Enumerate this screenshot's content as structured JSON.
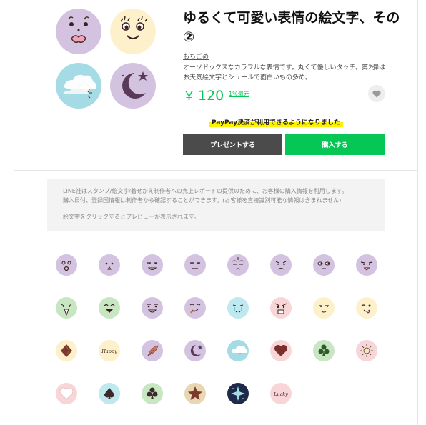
{
  "product": {
    "title": "ゆるくて可愛い表情の絵文字、その②",
    "author": "もちごめ",
    "description": "オーソドックスなカラフルな表情です。丸くて優しいタッチ。第2弾はお天気絵文字とシュールで面白いもの多め。",
    "price_symbol": "￥",
    "price_value": "120",
    "coin_link": "1%還元",
    "favorite_icon": "heart-icon",
    "paypay_notice": "PayPay決済が利用できるようになりました",
    "present_label": "プレゼントする",
    "buy_label": "購入する"
  },
  "colors": {
    "accent": "#06c755",
    "dark_button": "#4b4b4b",
    "highlight": "#fff200",
    "lavender": "#d3c3e0",
    "cream": "#fdf1cc",
    "sky": "#a5dbe4",
    "mint": "#c8e6c2",
    "peach": "#fbe0cb",
    "pink": "#f8d6d8",
    "brown": "#7a3b2a"
  },
  "main_images": [
    {
      "name": "lips-face",
      "icon": "lips-face-icon"
    },
    {
      "name": "curly-eyes-face",
      "icon": "smile-face-icon"
    },
    {
      "name": "cloudy-sun",
      "icon": "cloud-sun-icon"
    },
    {
      "name": "moon-star",
      "icon": "moon-star-icon"
    }
  ],
  "notice": {
    "line1": "LINE社はスタンプ/絵文字/着せかえ制作者への売上レポートの提供のために、お客様の購入情報を利用します。",
    "line2": "購入日付、登録国情報は制作者から確認することができます。(お客様を直接識別可能な情報は含まれません)",
    "line3": "絵文字をクリックするとプレビューが表示されます。"
  },
  "emojis": [
    {
      "icon": "surprised-face-icon"
    },
    {
      "icon": "small-mouth-face-icon"
    },
    {
      "icon": "grin-face-icon"
    },
    {
      "icon": "flat-face-icon"
    },
    {
      "icon": "sweating-face-icon"
    },
    {
      "icon": "worried-face-icon"
    },
    {
      "icon": "side-eye-face-icon"
    },
    {
      "icon": "tongue-face-icon"
    },
    {
      "icon": "shout-face-icon"
    },
    {
      "icon": "laughing-face-icon"
    },
    {
      "icon": "smirk-face-icon"
    },
    {
      "icon": "drool-face-icon"
    },
    {
      "icon": "crying-face-icon"
    },
    {
      "icon": "angry-face-icon"
    },
    {
      "icon": "smug-face-icon"
    },
    {
      "icon": "wink-tongue-face-icon"
    },
    {
      "icon": "chocolate-diamond-icon"
    },
    {
      "icon": "happy-text-icon",
      "text": "Happy"
    },
    {
      "icon": "feather-icon"
    },
    {
      "icon": "moon-star-icon"
    },
    {
      "icon": "cloudy-icon"
    },
    {
      "icon": "heart-icon"
    },
    {
      "icon": "club-icon"
    },
    {
      "icon": "sun-icon"
    },
    {
      "icon": "heart-outline-icon"
    },
    {
      "icon": "spade-icon"
    },
    {
      "icon": "club-icon"
    },
    {
      "icon": "star-icon"
    },
    {
      "icon": "sparkle-star-icon"
    },
    {
      "icon": "lucky-text-icon",
      "text": "Lucky"
    }
  ]
}
